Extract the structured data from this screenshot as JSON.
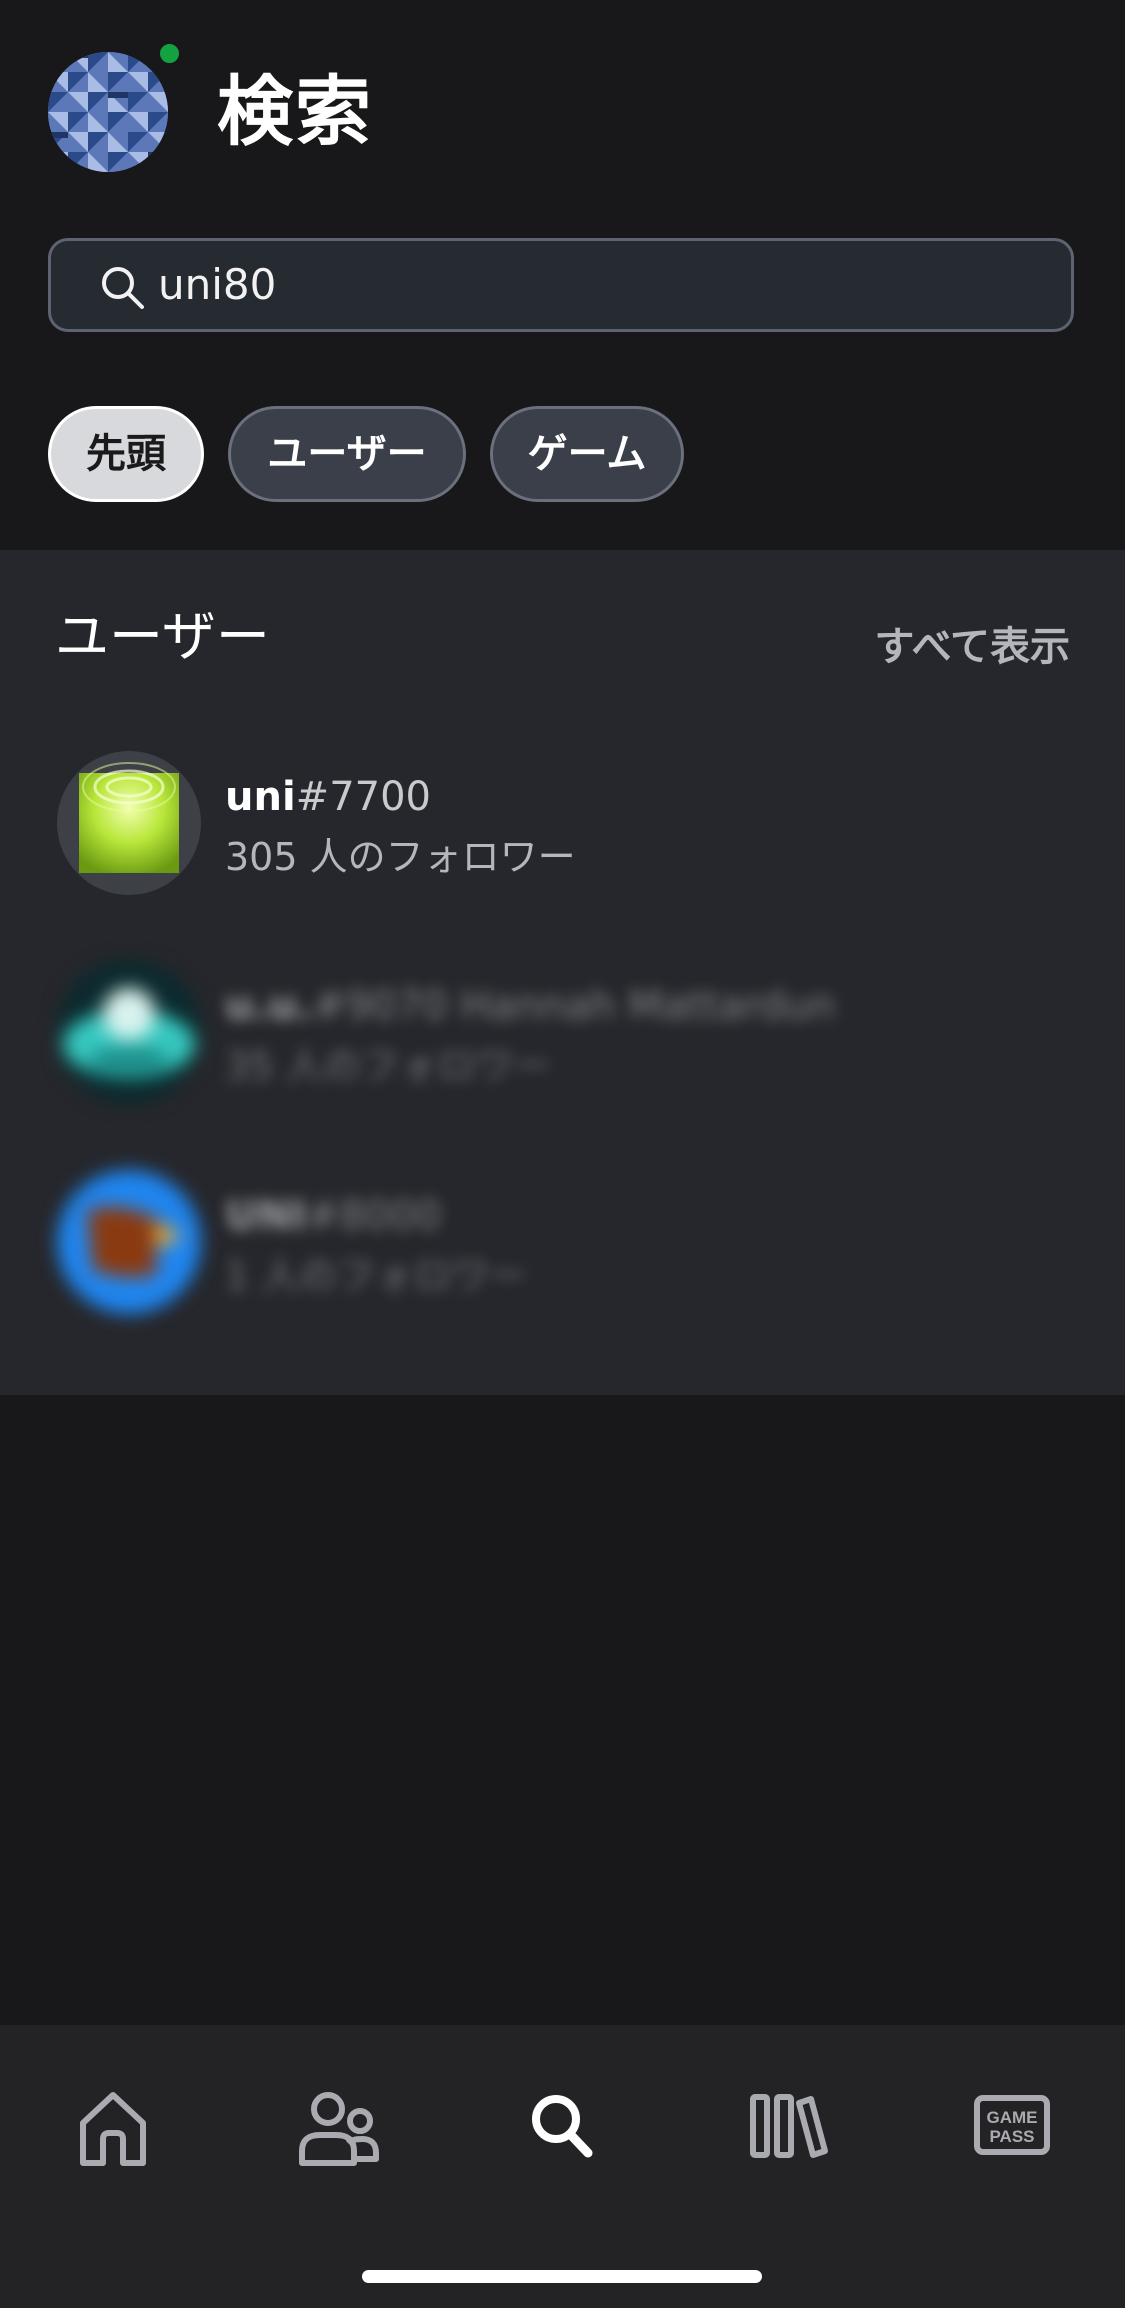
{
  "header": {
    "title": "検索",
    "profile_icon": "avatar-geometric-pattern",
    "online_status_color": "#13a23f"
  },
  "search": {
    "query": "uni80",
    "icon": "search-icon"
  },
  "filters": [
    {
      "label": "先頭",
      "selected": true
    },
    {
      "label": "ユーザー",
      "selected": false
    },
    {
      "label": "ゲーム",
      "selected": false
    }
  ],
  "users_section": {
    "title": "ユーザー",
    "see_all_label": "すべて表示",
    "items": [
      {
        "gamertag": "uni",
        "suffix": "#7700",
        "followers": "305 人のフォロワー",
        "avatar": "green-ripple-avatar",
        "blurred": false
      },
      {
        "gamertag": "u.u.",
        "suffix": "#9070 Hannah Mattardun",
        "followers": "35 人のフォロワー",
        "avatar": "teal-character-avatar",
        "blurred": true
      },
      {
        "gamertag": "UNI",
        "suffix": "#8000",
        "followers": "1 人のフォロワー",
        "avatar": "eagle-avatar",
        "blurred": true
      }
    ]
  },
  "nav": {
    "items": [
      {
        "name": "home",
        "icon": "home-icon",
        "active": false
      },
      {
        "name": "social",
        "icon": "people-icon",
        "active": false
      },
      {
        "name": "search",
        "icon": "search-icon",
        "active": true
      },
      {
        "name": "library",
        "icon": "library-icon",
        "active": false
      },
      {
        "name": "game-pass",
        "icon": "game-pass-icon",
        "label_line1": "GAME",
        "label_line2": "PASS",
        "active": false
      }
    ]
  },
  "colors": {
    "background": "#18181a",
    "section_background": "#26272c",
    "nav_background": "#232325",
    "chip_selected": "#d8d9dd",
    "chip_default": "#3a3f4a",
    "muted_text": "#b4b6bb"
  }
}
